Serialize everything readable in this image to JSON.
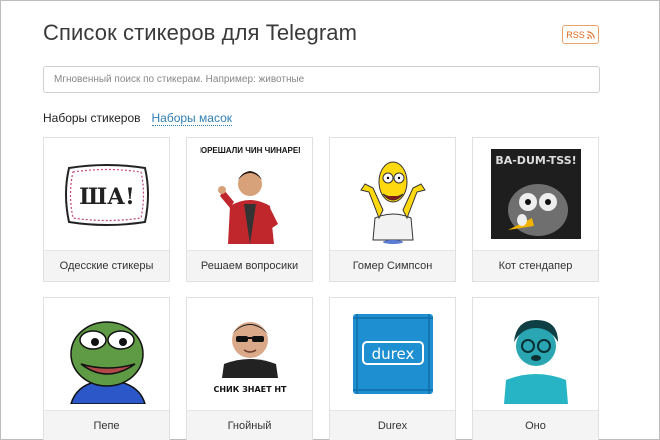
{
  "page": {
    "title": "Список стикеров для Telegram",
    "rss_label": "RSS"
  },
  "search": {
    "placeholder": "Мгновенный поиск по стикерам. Например: животные"
  },
  "tabs": [
    {
      "label": "Наборы стикеров",
      "active": true
    },
    {
      "label": "Наборы масок",
      "active": false
    }
  ],
  "sticker_sets": [
    {
      "name": "Одесские стикеры",
      "image_text": "ША!"
    },
    {
      "name": "Решаем вопросики",
      "image_text": "ПОРЕШАЛИ ЧИН ЧИНАРЕМ"
    },
    {
      "name": "Гомер Симпсон"
    },
    {
      "name": "Кот стендапер",
      "image_text": "BA-DUM-TSS!"
    },
    {
      "name": "Пепе"
    },
    {
      "name": "Гнойный",
      "image_text": "СНИК ЗНАЕТ НТ"
    },
    {
      "name": "Durex",
      "image_text": "durex"
    },
    {
      "name": "Оно"
    }
  ],
  "colors": {
    "accent_link": "#2f7fb5",
    "rss_orange": "#e06a1c"
  }
}
